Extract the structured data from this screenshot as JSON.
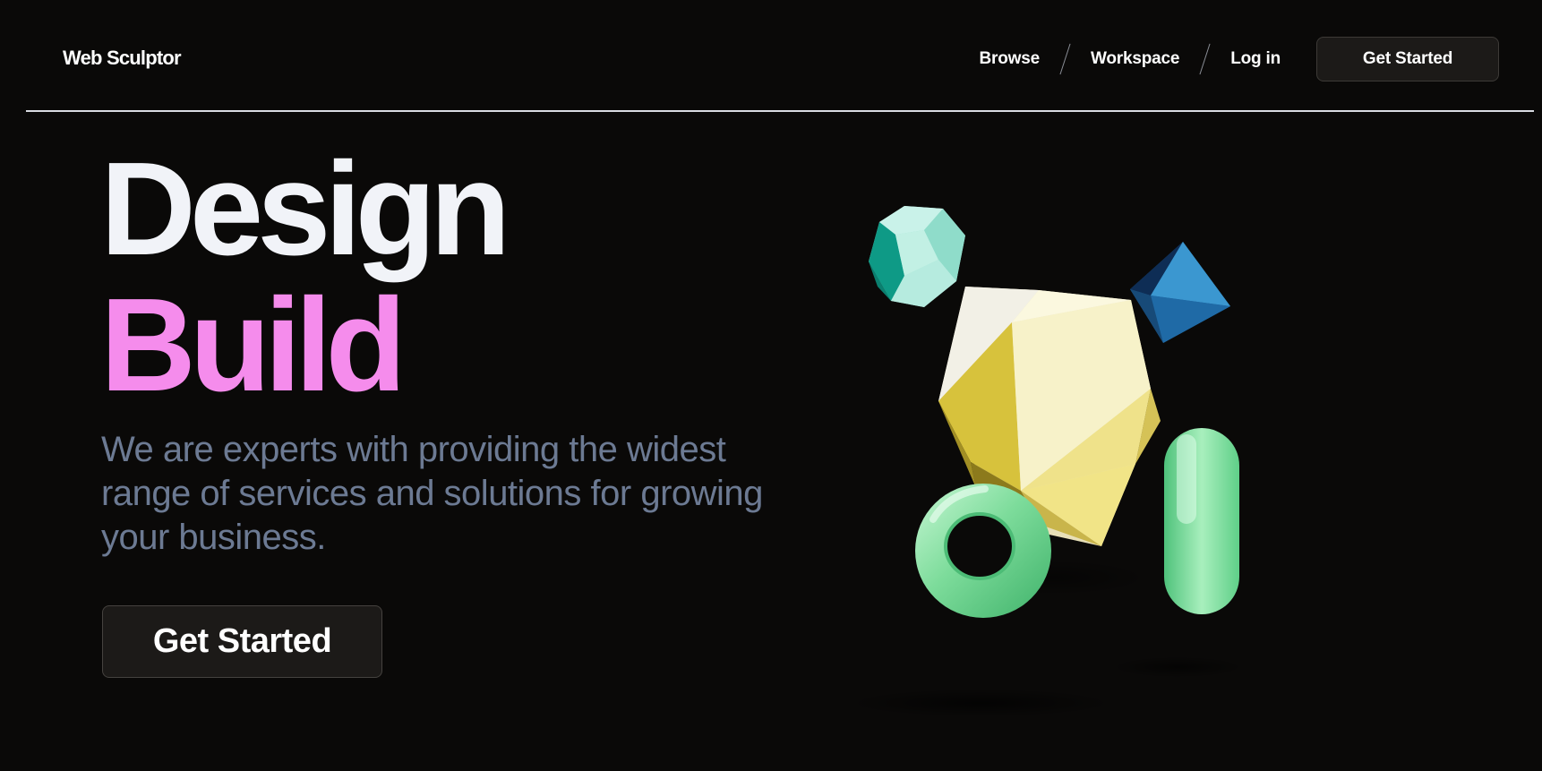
{
  "header": {
    "logo": "Web Sculptor",
    "nav": [
      {
        "label": "Browse"
      },
      {
        "label": "Workspace"
      },
      {
        "label": "Log in"
      }
    ],
    "cta_label": "Get Started"
  },
  "hero": {
    "headline_1": "Design",
    "headline_2": "Build",
    "subtitle": "We are experts with providing the widest range of services and solutions for growing your business.",
    "cta_label": "Get Started"
  },
  "colors": {
    "background": "#0a0908",
    "headline": "#f1f3f8",
    "accent_pink": "#f58cec",
    "subtitle": "#6c7a93",
    "button_bg": "#1c1a18"
  },
  "illustration": {
    "icons": [
      "teal-dodecahedron",
      "yellow-icosahedron",
      "blue-octahedron",
      "green-torus",
      "green-capsule"
    ]
  }
}
